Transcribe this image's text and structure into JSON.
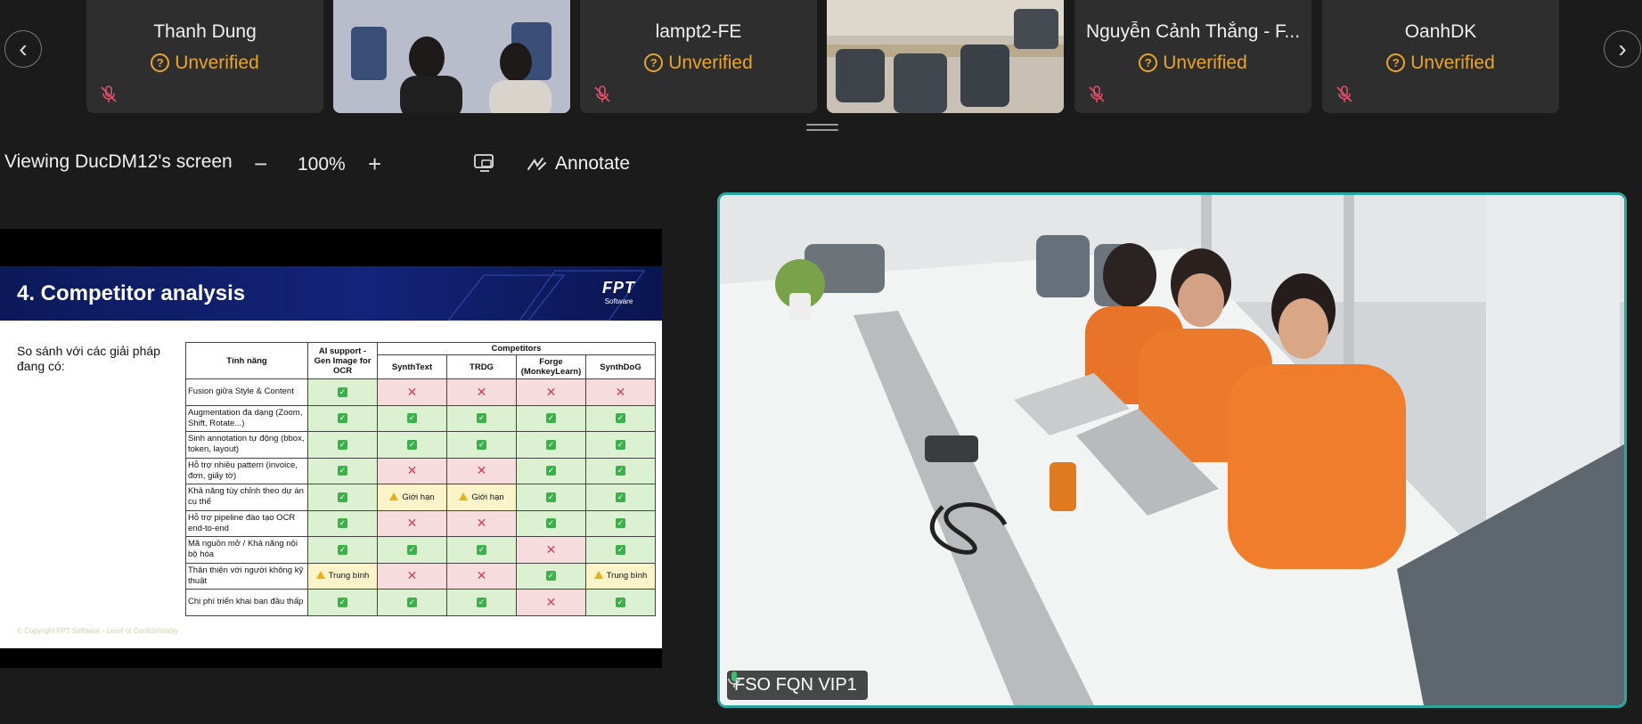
{
  "participants": [
    {
      "name": "Thanh Dung",
      "status": "Unverified",
      "kind": "avatar"
    },
    {
      "name": "",
      "status": "",
      "kind": "video"
    },
    {
      "name": "lampt2-FE",
      "status": "Unverified",
      "kind": "avatar"
    },
    {
      "name": "",
      "status": "",
      "kind": "video"
    },
    {
      "name": "Nguyễn Cảnh Thắng - F...",
      "status": "Unverified",
      "kind": "avatar"
    },
    {
      "name": "OanhDK",
      "status": "Unverified",
      "kind": "avatar"
    }
  ],
  "toolbar": {
    "viewing_label": "Viewing DucDM12's screen",
    "zoom_level": "100%",
    "annotate_label": "Annotate"
  },
  "slide": {
    "title": "4. Competitor analysis",
    "logo_text": "FPT",
    "logo_sub": "Software",
    "note": "So sánh với các giải pháp đang có:",
    "footer": "© Copyright FPT Software - Level of Confidentiality",
    "table": {
      "feature_header": "Tính năng",
      "own_header": "AI support - Gen Image for OCR",
      "competitors_header": "Competitors",
      "competitors": [
        "SynthText",
        "TRDG",
        "Forge (MonkeyLearn)",
        "SynthDoG"
      ],
      "rows": [
        {
          "feature": "Fusion giữa Style & Content",
          "cells": [
            "ok",
            "no",
            "no",
            "no",
            "no"
          ]
        },
        {
          "feature": "Augmentation đa dạng (Zoom, Shift, Rotate...)",
          "cells": [
            "ok",
            "ok",
            "ok",
            "ok",
            "ok"
          ]
        },
        {
          "feature": "Sinh annotation tự động (bbox, token, layout)",
          "cells": [
            "ok",
            "ok",
            "ok",
            "ok",
            "ok"
          ]
        },
        {
          "feature": "Hỗ trợ nhiều pattern (invoice, đơn, giấy tờ)",
          "cells": [
            "ok",
            "no",
            "no",
            "ok",
            "ok"
          ]
        },
        {
          "feature": "Khả năng tùy chỉnh theo dự án cụ thể",
          "cells": [
            "ok",
            "lim",
            "lim",
            "ok",
            "ok"
          ]
        },
        {
          "feature": "Hỗ trợ pipeline đào tạo OCR end-to-end",
          "cells": [
            "ok",
            "no",
            "no",
            "ok",
            "ok"
          ]
        },
        {
          "feature": "Mã nguồn mở / Khả năng nội bộ hóa",
          "cells": [
            "ok",
            "ok",
            "ok",
            "no",
            "ok"
          ]
        },
        {
          "feature": "Thân thiện với người không kỹ thuật",
          "cells": [
            "mid",
            "no",
            "no",
            "ok",
            "mid"
          ]
        },
        {
          "feature": "Chi phí triển khai ban đầu thấp",
          "cells": [
            "ok",
            "ok",
            "ok",
            "no",
            "ok"
          ]
        }
      ],
      "limited_label": "Giới hạn",
      "medium_label": "Trung bình"
    }
  },
  "speaker": {
    "name": "FSO FQN VIP1"
  },
  "colors": {
    "unverified": "#e8a52a",
    "active_border": "#29a6a0",
    "slide_header": "#13237a"
  },
  "icons": [
    "chevron-left-icon",
    "chevron-right-icon",
    "mic-muted-icon",
    "unverified-icon",
    "zoom-minus-icon",
    "zoom-plus-icon",
    "screen-icon",
    "annotate-icon",
    "mic-active-icon"
  ]
}
